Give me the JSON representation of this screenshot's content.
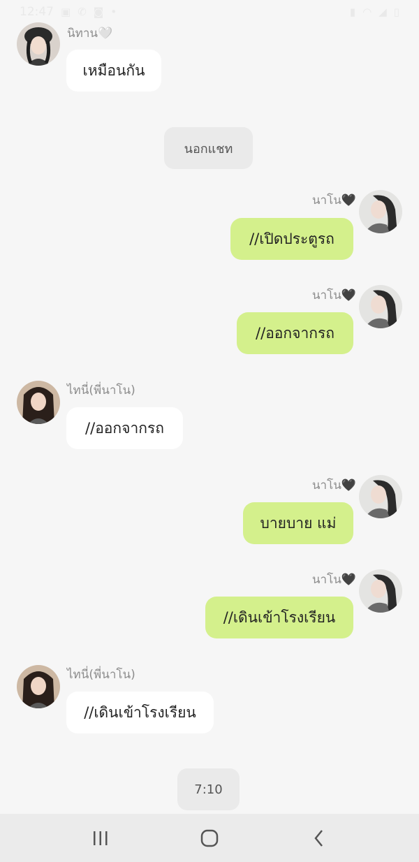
{
  "status_bar": {
    "time": "12:47"
  },
  "messages": {
    "m1": {
      "sender": "นิทาน🤍",
      "text": "เหมือนกัน"
    },
    "sys1": {
      "text": "นอกแชท"
    },
    "m2": {
      "sender": "นาโน🖤",
      "text": "//เปิดประตูรถ"
    },
    "m3": {
      "sender": "นาโน🖤",
      "text": "//ออกจากรถ"
    },
    "m4": {
      "sender": "ไทนี่(พี่นาโน)",
      "text": "//ออกจากรถ"
    },
    "m5": {
      "sender": "นาโน🖤",
      "text": "บายบาย แม่"
    },
    "m6": {
      "sender": "นาโน🖤",
      "text": "//เดินเข้าโรงเรียน"
    },
    "m7": {
      "sender": "ไทนี่(พี่นาโน)",
      "text": "//เดินเข้าโรงเรียน"
    },
    "sys2": {
      "text": "7:10"
    }
  },
  "icons": {
    "nav_recent": "recent-apps-icon",
    "nav_home": "home-icon",
    "nav_back": "back-icon"
  },
  "colors": {
    "outgoing_bubble": "#d4f08c",
    "incoming_bubble": "#ffffff",
    "background": "#f6f6f6"
  }
}
